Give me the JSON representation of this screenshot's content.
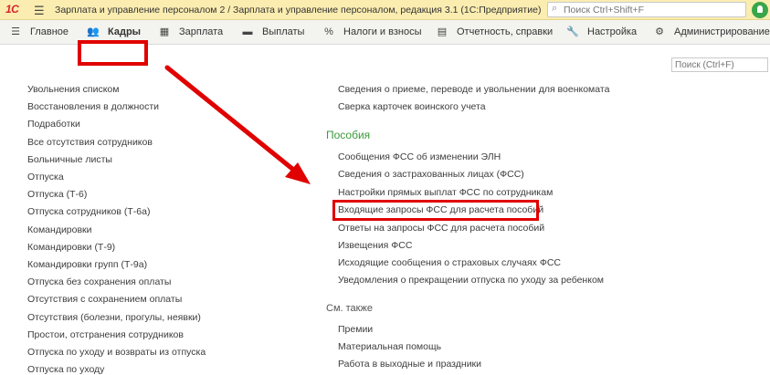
{
  "titlebar": {
    "logo": "1С",
    "title": "Зарплата и управление персоналом 2 / Зарплата и управление персоналом, редакция 3.1  (1С:Предприятие)",
    "search_placeholder": "Поиск Ctrl+Shift+F"
  },
  "menu": {
    "items": [
      {
        "label": "Главное",
        "icon": "menu-lines-icon"
      },
      {
        "label": "Кадры",
        "icon": "people-icon"
      },
      {
        "label": "Зарплата",
        "icon": "calculator-icon"
      },
      {
        "label": "Выплаты",
        "icon": "wallet-icon"
      },
      {
        "label": "Налоги и взносы",
        "icon": "percent-icon"
      },
      {
        "label": "Отчетность, справки",
        "icon": "report-icon"
      },
      {
        "label": "Настройка",
        "icon": "wrench-icon"
      },
      {
        "label": "Администрирование",
        "icon": "gear-icon"
      }
    ],
    "active_color": "#e00000"
  },
  "panel": {
    "search_placeholder": "Поиск (Ctrl+F)"
  },
  "left_links": [
    "Увольнения списком",
    "Восстановления в должности",
    "Подработки",
    "Все отсутствия сотрудников",
    "Больничные листы",
    "Отпуска",
    "Отпуска (Т-6)",
    "Отпуска сотрудников (Т-6а)",
    "Командировки",
    "Командировки (Т-9)",
    "Командировки групп (Т-9а)",
    "Отпуска без сохранения оплаты",
    "Отсутствия с сохранением оплаты",
    "Отсутствия (болезни, прогулы, неявки)",
    "Простои, отстранения сотрудников",
    "Отпуска по уходу и возвраты из отпуска",
    "Отпуска по уходу"
  ],
  "right_top_links": [
    "Сведения о приеме, переводе и увольнении для военкомата",
    "Сверка карточек воинского учета"
  ],
  "benefits": {
    "header": "Пособия",
    "links": [
      "Сообщения ФСС об изменении ЭЛН",
      "Сведения о застрахованных лицах (ФСС)",
      "Настройки прямых выплат ФСС по сотрудникам",
      "Входящие запросы ФСС для расчета пособий",
      "Ответы на запросы ФСС для расчета пособий",
      "Извещения ФСС",
      "Исходящие сообщения о страховых случаях ФСС",
      "Уведомления о прекращении отпуска по уходу за ребенком"
    ]
  },
  "see_also": {
    "header": "См. также",
    "links": [
      "Премии",
      "Материальная помощь",
      "Работа в выходные и праздники"
    ]
  },
  "colors": {
    "titlebar": "#fbedb0",
    "menubar": "#f3f3f0",
    "section_header": "#3b9a3b",
    "annotation": "#e00000"
  }
}
